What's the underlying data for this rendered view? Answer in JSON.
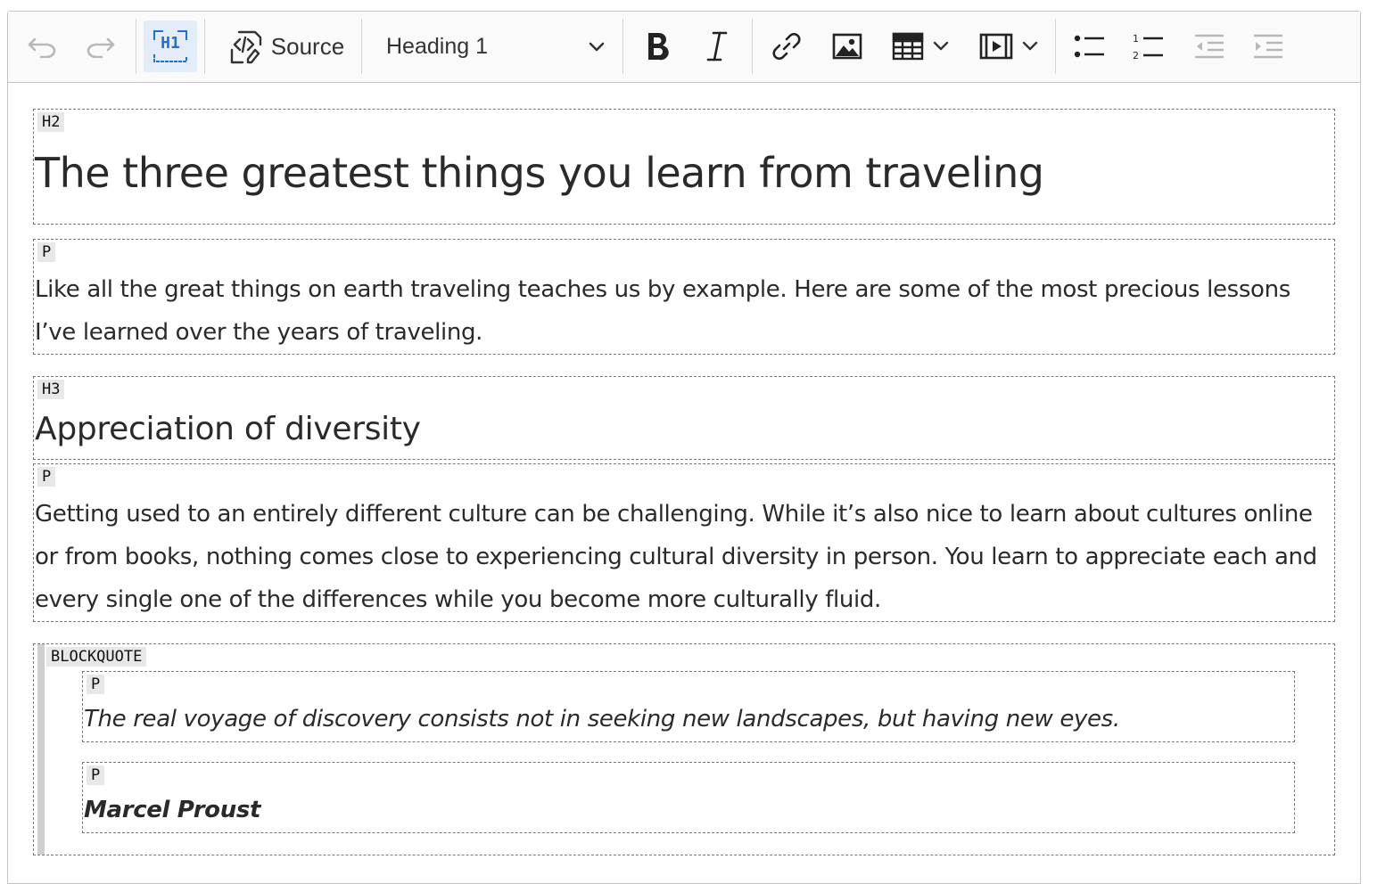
{
  "toolbar": {
    "undo_icon": "undo-icon",
    "redo_icon": "redo-icon",
    "show_blocks_label": "H1",
    "source_label": "Source",
    "heading_value": "Heading 1",
    "bold_icon": "bold-icon",
    "italic_icon": "italic-icon",
    "link_icon": "link-icon",
    "image_icon": "image-icon",
    "table_icon": "table-icon",
    "media_icon": "media-icon",
    "bulleted_list_icon": "bulleted-list-icon",
    "numbered_list_icon": "numbered-list-icon",
    "outdent_icon": "outdent-icon",
    "indent_icon": "indent-icon",
    "active_color": "#1f6fd6"
  },
  "content": {
    "blocks": [
      {
        "tag": "H2",
        "text": "The three greatest things you learn from traveling"
      },
      {
        "tag": "P",
        "text": "Like all the great things on earth traveling teaches us by example. Here are some of the most precious lessons I’ve learned over the years of traveling."
      },
      {
        "tag": "H3",
        "text": "Appreciation of diversity"
      },
      {
        "tag": "P",
        "text": "Getting used to an entirely different culture can be challenging. While it’s also nice to learn about cultures online or from books, nothing comes close to experiencing cultural diversity in person. You learn to appreciate each and every single one of the differences while you become more culturally fluid."
      }
    ],
    "blockquote": {
      "tag": "BLOCKQUOTE",
      "paragraphs": [
        {
          "tag": "P",
          "text": "The real voyage of discovery consists not in seeking new landscapes, but having new eyes."
        },
        {
          "tag": "P",
          "text": "Marcel Proust"
        }
      ]
    }
  }
}
